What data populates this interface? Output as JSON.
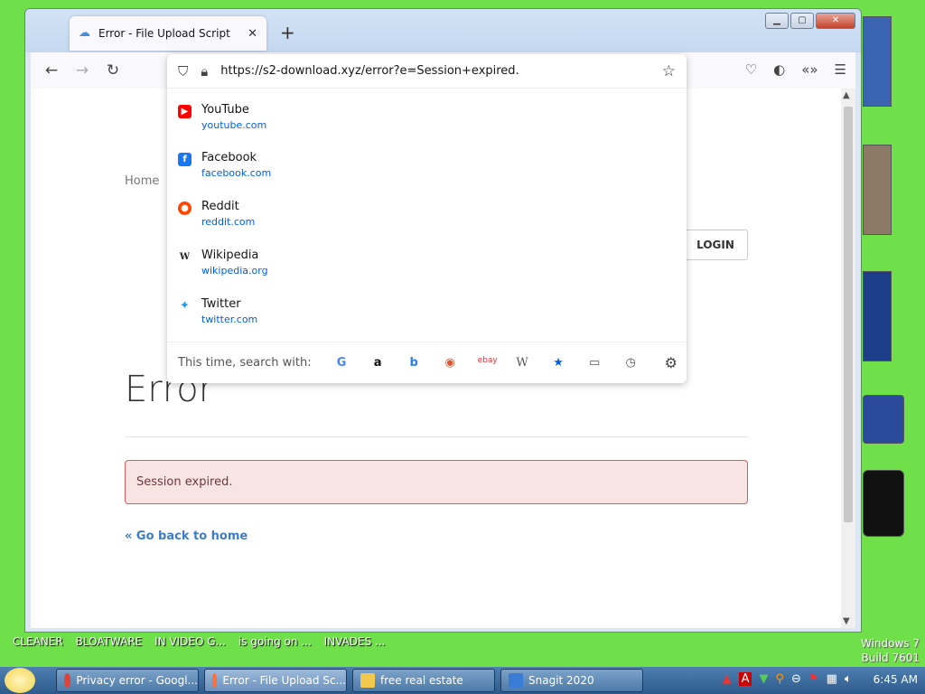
{
  "desktop": {
    "labels": [
      "CLEANER",
      "BLOATWARE",
      "IN VIDEO G...",
      "is going on ...",
      "INVADES ..."
    ],
    "windows_version": "Windows 7",
    "build": "Build 7601"
  },
  "browser": {
    "tab_title": "Error - File Upload Script",
    "address": "https://s2-download.xyz/error?e=Session+expired.",
    "suggestions": [
      {
        "title": "YouTube",
        "url": "youtube.com",
        "color": "#ff0000",
        "glyph": "▶"
      },
      {
        "title": "Facebook",
        "url": "facebook.com",
        "color": "#1877f2",
        "glyph": "f"
      },
      {
        "title": "Reddit",
        "url": "reddit.com",
        "color": "#ff4500",
        "glyph": "●"
      },
      {
        "title": "Wikipedia",
        "url": "wikipedia.org",
        "color": "#333333",
        "glyph": "W"
      },
      {
        "title": "Twitter",
        "url": "twitter.com",
        "color": "#1d9bf0",
        "glyph": "✦"
      }
    ],
    "search_with_label": "This time, search with:",
    "engines": [
      "google-icon",
      "amazon-icon",
      "bing-icon",
      "duckduckgo-icon",
      "ebay-icon",
      "wikipedia-icon",
      "bookmarks-icon",
      "tabs-icon",
      "history-icon"
    ]
  },
  "page": {
    "home_link": "Home",
    "login_label": "LOGIN",
    "heading": "Error",
    "alert_text": "Session expired.",
    "back_link": "« Go back to home"
  },
  "taskbar": {
    "items": [
      {
        "label": "Privacy error - Googl...",
        "color": "#db4437",
        "active": false
      },
      {
        "label": "Error - File Upload Sc...",
        "color": "#ff7139",
        "active": true
      },
      {
        "label": "free real estate",
        "color": "#f2c94c",
        "active": false
      },
      {
        "label": "Snagit 2020",
        "color": "#3a7bd5",
        "active": false
      }
    ],
    "clock": "6:45 AM"
  }
}
